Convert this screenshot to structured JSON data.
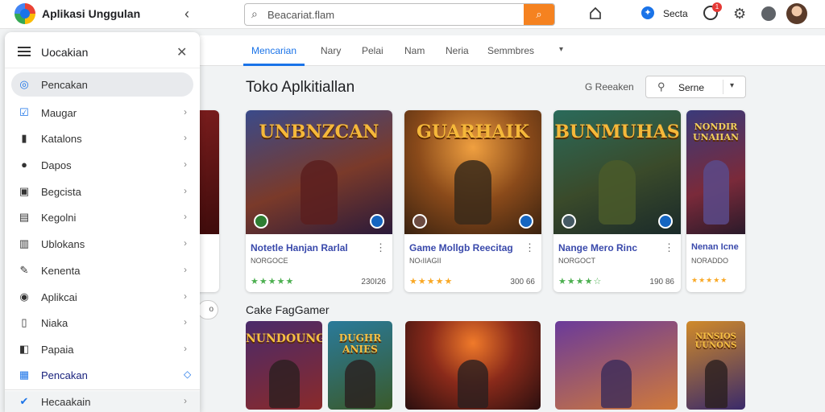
{
  "app": {
    "name": "Aplikasi Unggulan"
  },
  "header": {
    "search_placeholder": "Beacariat.flam",
    "user_label": "Secta",
    "notification_count": "1"
  },
  "tabs": [
    "Mencarian",
    "Nary",
    "Pelai",
    "Nam",
    "Neria",
    "Semmbres"
  ],
  "main": {
    "title": "Toko Aplkitiallan",
    "sort_hint": "G Reeaken",
    "sort_value": "Serne",
    "section2_title": "Cake FagGamer"
  },
  "cards": [
    {
      "art_title": "UNBNZCAN",
      "title": "Notetle Hanjan Rarlal",
      "subtitle": "NORGOCE",
      "stars": "★★★★★",
      "count": "230I26"
    },
    {
      "art_title": "GUARHAIK",
      "title": "Game Mollgb Reecitag",
      "subtitle": "NO‹IIAGII",
      "stars": "★★★★★",
      "count": "300 66"
    },
    {
      "art_title": "BUNMUHAS",
      "title": "Nange Mero Rinc",
      "subtitle": "NORGOCT",
      "stars": "★★★★☆",
      "count": "190 86"
    },
    {
      "art_title": "NONDIR UNAIIAN",
      "title": "Nenan Icne",
      "subtitle": "NORADDO",
      "stars": "★★★★★",
      "count": ""
    }
  ],
  "tiles": [
    {
      "title": "NUNDOUNGAN"
    },
    {
      "title": "DUGHR ANIES"
    },
    {
      "title": ""
    },
    {
      "title": ""
    },
    {
      "title": "NINSIOS UUNONS"
    }
  ],
  "drawer": {
    "title": "Uocakian",
    "items": [
      {
        "label": "Pencakan",
        "icon": "compass-icon"
      },
      {
        "label": "Maugar",
        "icon": "checkbox-icon"
      },
      {
        "label": "Katalons",
        "icon": "bookmark-icon"
      },
      {
        "label": "Dapos",
        "icon": "person-icon"
      },
      {
        "label": "Begcista",
        "icon": "calendar-icon"
      },
      {
        "label": "Kegolni",
        "icon": "ticket-icon"
      },
      {
        "label": "Ublokans",
        "icon": "shelf-icon"
      },
      {
        "label": "Kenenta",
        "icon": "edit-icon"
      },
      {
        "label": "Aplikcai",
        "icon": "shield-icon"
      },
      {
        "label": "Niaka",
        "icon": "bookmark-icon"
      },
      {
        "label": "Papaia",
        "icon": "label-icon"
      },
      {
        "label": "Pencakan",
        "icon": "grid-icon"
      }
    ],
    "footer_label": "Hecaakain"
  }
}
